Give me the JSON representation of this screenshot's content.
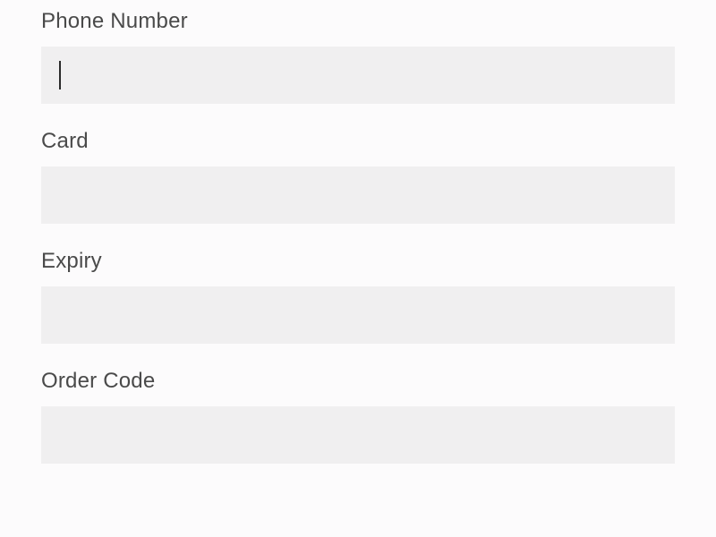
{
  "form": {
    "fields": [
      {
        "label": "Phone Number",
        "value": "",
        "focused": true
      },
      {
        "label": "Card",
        "value": "",
        "focused": false
      },
      {
        "label": "Expiry",
        "value": "",
        "focused": false
      },
      {
        "label": "Order Code",
        "value": "",
        "focused": false
      }
    ]
  }
}
